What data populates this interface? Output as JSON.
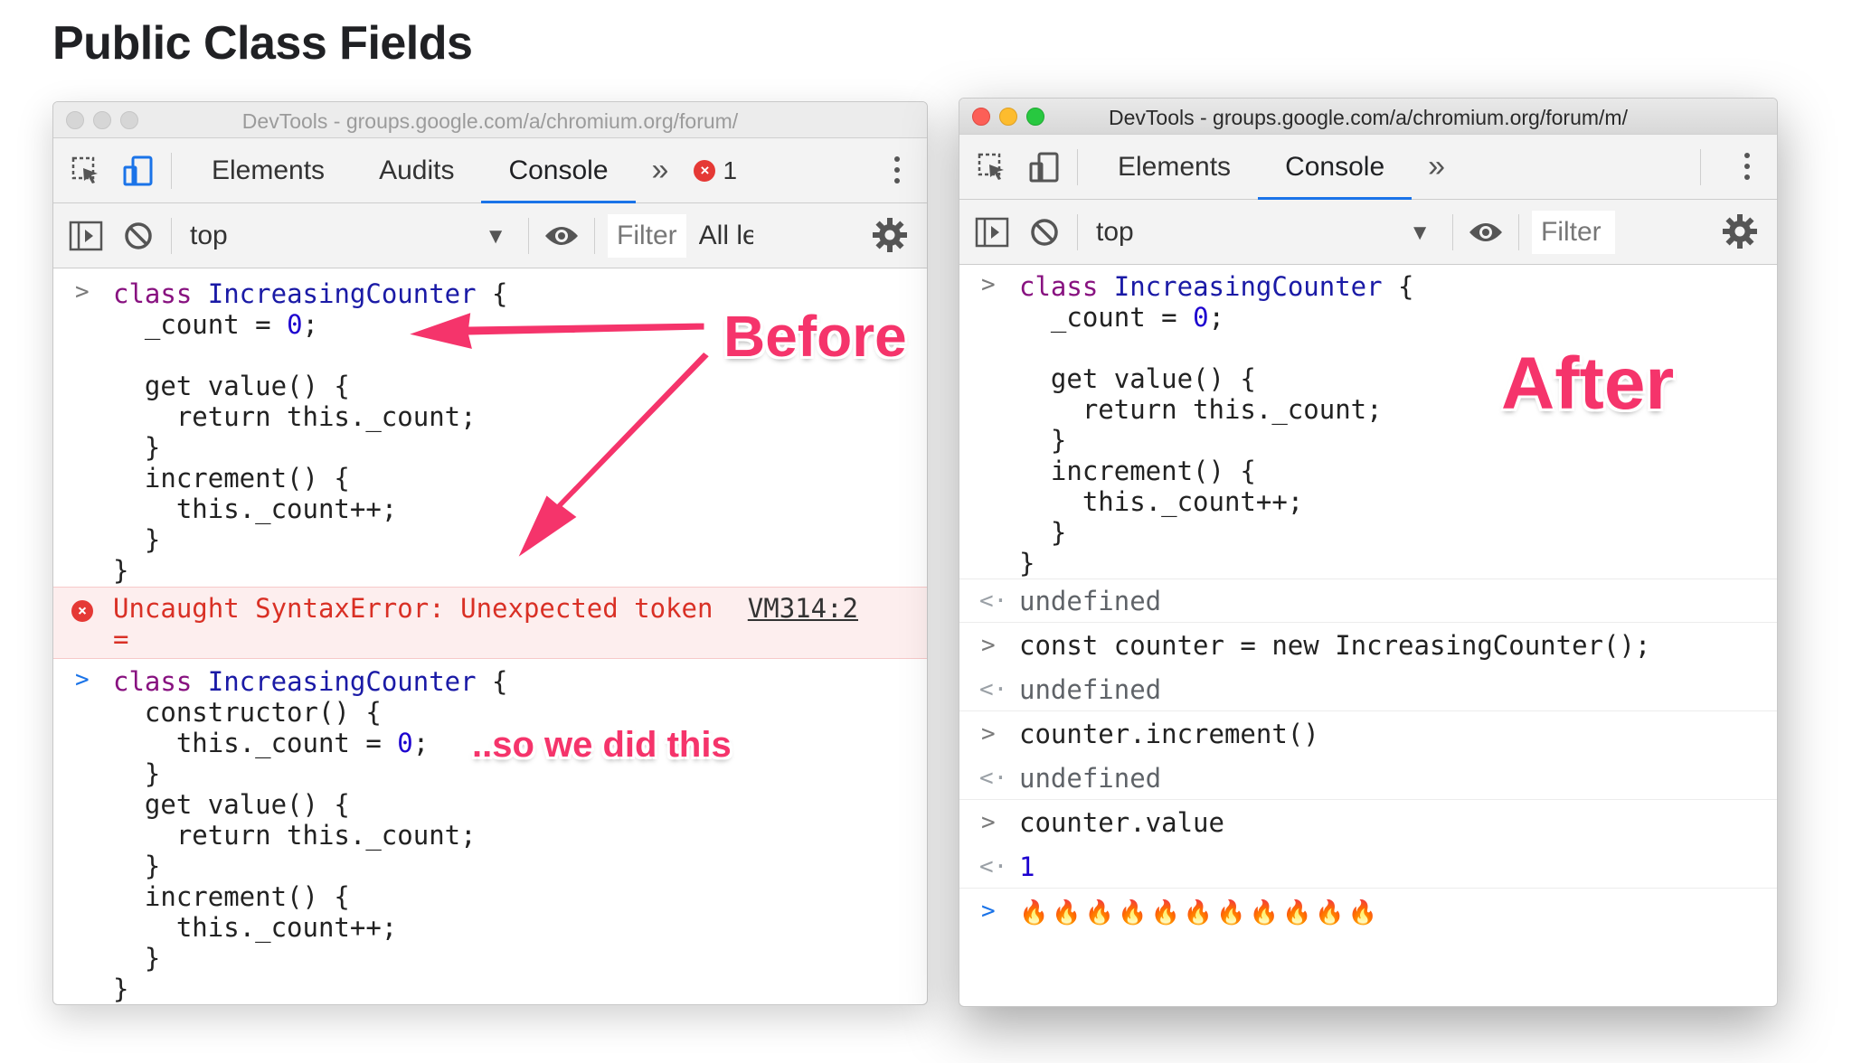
{
  "slide": {
    "title": "Public Class Fields"
  },
  "left": {
    "window_title": "DevTools - groups.google.com/a/chromium.org/forum/",
    "tabs": [
      "Elements",
      "Audits",
      "Console"
    ],
    "more_tabs": "»",
    "error_count": "1",
    "context": "top",
    "filter_placeholder": "Filter",
    "levels": "All le",
    "input1": [
      [
        "class ",
        "IncreasingCounter",
        " {"
      ],
      [
        "  _count = ",
        "0",
        ";"
      ],
      [
        ""
      ],
      [
        "  get value() {"
      ],
      [
        "    return this._count;"
      ],
      [
        "  }"
      ],
      [
        "  increment() {"
      ],
      [
        "    this._count++;"
      ],
      [
        "  }"
      ],
      [
        "}"
      ]
    ],
    "error_line1": "Uncaught SyntaxError: Unexpected token",
    "error_line2": "=",
    "error_source": "VM314:2",
    "input2": {
      "l1a": "class ",
      "l1b": "IncreasingCounter",
      "l1c": " {",
      "l2": "  constructor() {",
      "l3a": "    this._count = ",
      "l3b": "0",
      "l3c": ";",
      "l4": "  }",
      "l5": "  get value() {",
      "l6": "    return this._count;",
      "l7": "  }",
      "l8": "  increment() {",
      "l9": "    this._count++;",
      "l10": "  }",
      "l11": "}"
    }
  },
  "right": {
    "window_title": "DevTools - groups.google.com/a/chromium.org/forum/m/",
    "tabs": [
      "Elements",
      "Console"
    ],
    "more_tabs": "»",
    "context": "top",
    "filter_placeholder": "Filter",
    "undefined": "undefined",
    "cmd_const": "const counter = new IncreasingCounter();",
    "cmd_increment": "counter.increment()",
    "cmd_value": "counter.value",
    "result_value": "1",
    "last_input": "🔥🔥🔥🔥🔥🔥🔥🔥🔥🔥🔥"
  },
  "annotations": {
    "before": "Before",
    "after": "After",
    "so_we_did_this": "..so we did this"
  },
  "colors": {
    "accent": "#1a73e8",
    "annotation": "#f5346b",
    "error": "#d93025"
  }
}
